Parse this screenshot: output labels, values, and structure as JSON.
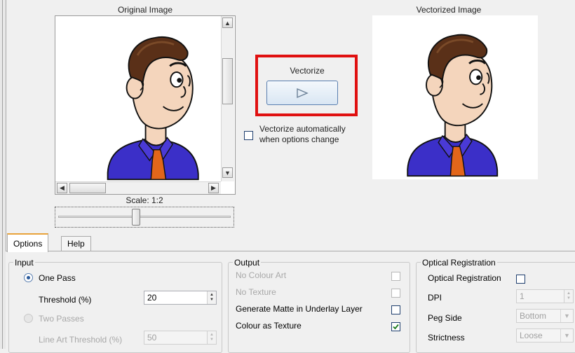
{
  "original": {
    "title": "Original Image",
    "scale_label": "Scale: 1:2",
    "scale_fraction": 0.45
  },
  "vectorized": {
    "title": "Vectorized Image"
  },
  "vectorize": {
    "label": "Vectorize",
    "auto_line1": "Vectorize automatically",
    "auto_line2": "when options change",
    "auto_checked": false
  },
  "tabs": [
    {
      "label": "Options",
      "active": true
    },
    {
      "label": "Help",
      "active": false
    }
  ],
  "input": {
    "legend": "Input",
    "one_pass": "One Pass",
    "threshold_label": "Threshold (%)",
    "threshold_value": "20",
    "two_passes": "Two Passes",
    "line_art_label": "Line Art Threshold (%)",
    "line_art_value": "50"
  },
  "output": {
    "legend": "Output",
    "no_colour_art": "No Colour Art",
    "no_texture": "No Texture",
    "generate_matte": "Generate Matte in Underlay Layer",
    "colour_as_texture": "Colour as Texture"
  },
  "optical": {
    "legend": "Optical Registration",
    "optical_label": "Optical Registration",
    "dpi_label": "DPI",
    "dpi_value": "1",
    "peg_label": "Peg Side",
    "peg_value": "Bottom",
    "strictness_label": "Strictness",
    "strictness_value": "Loose"
  }
}
